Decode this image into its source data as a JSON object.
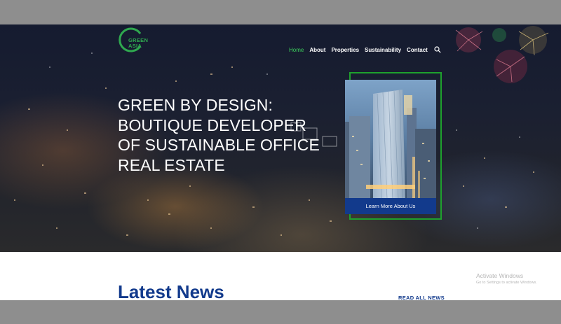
{
  "brand": {
    "logo_text_line1": "GREEN",
    "logo_text_line2": "ASIA",
    "accent": "#2fa84f"
  },
  "nav": {
    "items": [
      {
        "label": "Home",
        "active": true
      },
      {
        "label": "About"
      },
      {
        "label": "Properties"
      },
      {
        "label": "Sustainability"
      },
      {
        "label": "Contact"
      }
    ],
    "search_icon": "search-icon"
  },
  "hero": {
    "headline": "GREEN BY DESIGN: BOUTIQUE DEVELOPER OF SUSTAINABLE OFFICE REAL ESTATE",
    "cta_label": "Learn More About Us",
    "frame_color": "#1ea12d",
    "button_color": "#123a8c"
  },
  "news": {
    "title": "Latest News",
    "read_all_label": "READ ALL NEWS"
  },
  "os_notice": {
    "title": "Activate Windows",
    "subtitle": "Go to Settings to activate Windows."
  }
}
